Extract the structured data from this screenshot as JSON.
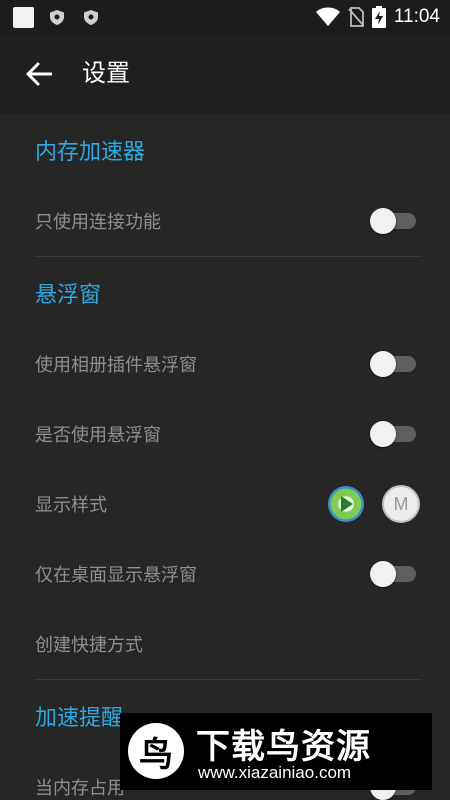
{
  "status_bar": {
    "time": "11:04",
    "icons": [
      "app-square-icon",
      "shield-icon",
      "shield-icon",
      "wifi-icon",
      "no-sim-icon",
      "battery-charging-icon"
    ]
  },
  "app_bar": {
    "title": "设置",
    "back_icon": "arrow-left-icon"
  },
  "sections": [
    {
      "title": "内存加速器",
      "items": [
        {
          "label": "只使用连接功能",
          "control": "switch",
          "on": false
        }
      ]
    },
    {
      "title": "悬浮窗",
      "items": [
        {
          "label": "使用相册插件悬浮窗",
          "control": "switch",
          "on": false
        },
        {
          "label": "是否使用悬浮窗",
          "control": "switch",
          "on": false
        },
        {
          "label": "显示样式",
          "control": "style-icons"
        },
        {
          "label": "仅在桌面显示悬浮窗",
          "control": "switch",
          "on": false
        },
        {
          "label": "创建快捷方式",
          "control": "none"
        }
      ]
    },
    {
      "title": "加速提醒",
      "items": [
        {
          "label": "当内存占用",
          "control": "switch",
          "on": false
        }
      ]
    }
  ],
  "style_icons": {
    "second_letter": "M"
  },
  "watermark": {
    "logo_char": "鸟",
    "title": "下载鸟资源",
    "url": "www.xiazainiao.com"
  },
  "colors": {
    "accent": "#2fa9df",
    "background": "#262626",
    "appbar": "#1f1f1f",
    "statusbar": "#1c1c1c"
  }
}
